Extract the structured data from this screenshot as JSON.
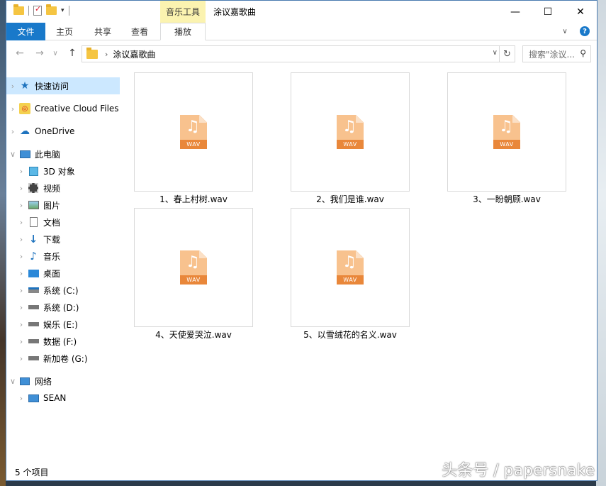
{
  "titlebar": {
    "tool_tab_header": "音乐工具",
    "window_title": "涂议嘉歌曲",
    "minimize": "—",
    "maximize": "☐",
    "close": "✕"
  },
  "ribbon": {
    "tabs": [
      "文件",
      "主页",
      "共享",
      "查看",
      "播放"
    ]
  },
  "address": {
    "crumb": "涂议嘉歌曲",
    "search_placeholder": "搜索\"涂议...",
    "back_icon": "arrow-left-icon",
    "forward_icon": "arrow-right-icon",
    "up_icon": "arrow-up-icon"
  },
  "navpane": {
    "items": [
      {
        "label": "快速访问",
        "icon": "star-icon"
      },
      {
        "label": "Creative Cloud Files",
        "icon": "creative-cloud-icon"
      },
      {
        "label": "OneDrive",
        "icon": "cloud-icon"
      },
      {
        "label": "此电脑",
        "icon": "computer-icon"
      },
      {
        "label": "3D 对象",
        "icon": "cube-icon"
      },
      {
        "label": "视频",
        "icon": "film-icon"
      },
      {
        "label": "图片",
        "icon": "picture-icon"
      },
      {
        "label": "文档",
        "icon": "document-icon"
      },
      {
        "label": "下载",
        "icon": "download-icon"
      },
      {
        "label": "音乐",
        "icon": "music-icon"
      },
      {
        "label": "桌面",
        "icon": "desktop-icon"
      },
      {
        "label": "系统 (C:)",
        "icon": "windows-drive-icon"
      },
      {
        "label": "系统 (D:)",
        "icon": "drive-icon"
      },
      {
        "label": "娱乐 (E:)",
        "icon": "drive-icon"
      },
      {
        "label": "数据 (F:)",
        "icon": "drive-icon"
      },
      {
        "label": "新加卷 (G:)",
        "icon": "drive-icon"
      },
      {
        "label": "网络",
        "icon": "network-icon"
      },
      {
        "label": "SEAN",
        "icon": "computer-icon"
      }
    ]
  },
  "files": [
    {
      "name": "1、春上村树.wav",
      "badge": "WAV"
    },
    {
      "name": "2、我们是谁.wav",
      "badge": "WAV"
    },
    {
      "name": "3、一盼朝顾.wav",
      "badge": "WAV"
    },
    {
      "name": "4、天使爱哭泣.wav",
      "badge": "WAV"
    },
    {
      "name": "5、以雪绒花的名义.wav",
      "badge": "WAV"
    }
  ],
  "status": {
    "count": "5 个项目"
  },
  "watermark": "头条号 / papersnake",
  "colors": {
    "accent": "#1979ca",
    "selection": "#cce8ff",
    "tool_tab": "#fbf3b0",
    "wav_band": "#e9873a"
  }
}
